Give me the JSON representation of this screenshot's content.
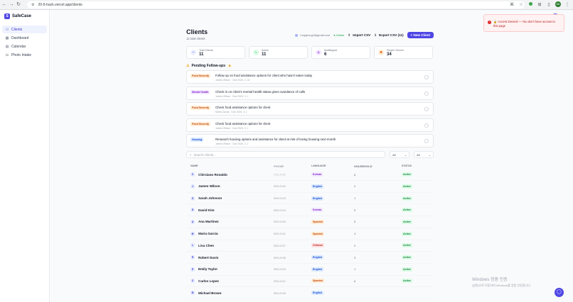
{
  "browser": {
    "url": "20-6-hack.vercel.app/clients",
    "back": "←",
    "forward": "→",
    "reload": "↻"
  },
  "brand": {
    "logo": "S",
    "name": "SafeCase"
  },
  "sidebar": {
    "items": [
      {
        "label": "Clients",
        "icon": "users-icon",
        "glyph": "⚇"
      },
      {
        "label": "Dashboard",
        "icon": "dashboard-icon",
        "glyph": "▦"
      },
      {
        "label": "Calendar",
        "icon": "calendar-icon",
        "glyph": "▤"
      },
      {
        "label": "Photo Intake",
        "icon": "camera-icon",
        "glyph": "◘"
      }
    ]
  },
  "header": {
    "title": "Clients",
    "subtitle": "11 total clients",
    "email": "hoipjeong2@gmail.com",
    "online": "● Online",
    "import_label": "Import CSV",
    "export_label": "Export CSV (11)",
    "new_label": "+ New Client"
  },
  "stats": [
    {
      "label": "Total Clients",
      "value": "11",
      "icon": "users-icon",
      "glyph": "⚇",
      "bg": "#eef2ff",
      "fg": "#4f46e5"
    },
    {
      "label": "Active",
      "value": "11",
      "icon": "activity-icon",
      "glyph": "∿",
      "bg": "#dcfce7",
      "fg": "#16a34a"
    },
    {
      "label": "Multilingual",
      "value": "6",
      "icon": "globe-icon",
      "glyph": "◍",
      "bg": "#f3e8ff",
      "fg": "#9333ea"
    },
    {
      "label": "People Served",
      "value": "34",
      "icon": "people-icon",
      "glyph": "⚉",
      "bg": "#ffedd5",
      "fg": "#ea580c"
    }
  ],
  "followups": {
    "title": "Pending Follow-ups",
    "count": "5",
    "items": [
      {
        "tag": "Food Security",
        "text": "Follow up on food assistance options for client who hasn't eaten today",
        "meta": "James Wilson · Due 2026. 2. 16"
      },
      {
        "tag": "Mental Health",
        "text": "Check in on client's mental health status given avoidance of calls",
        "meta": "James Wilson · Due 2026. 3. 1"
      },
      {
        "tag": "Food Security",
        "text": "Check food assistance options for client",
        "meta": "Maria Garcia · Due 2026. 3. 1"
      },
      {
        "tag": "Food Security",
        "text": "Check food assistance options for client",
        "meta": "James Wilson · Due 2026. 3. 1"
      },
      {
        "tag": "Housing",
        "text": "Research housing options and assistance for client at risk of losing housing next month",
        "meta": "James Wilson · Due 2026. 3. 1"
      }
    ]
  },
  "tag_colors": {
    "Food Security": {
      "bg": "#ffedd5",
      "fg": "#c2410c"
    },
    "Mental Health": {
      "bg": "#f3e8ff",
      "fg": "#7e22ce"
    },
    "Housing": {
      "bg": "#dbeafe",
      "fg": "#1d4ed8"
    }
  },
  "filters": {
    "search_placeholder": "Search clients...",
    "select1": "All",
    "select2": "All"
  },
  "table": {
    "headers": [
      "NAME",
      "PHONE",
      "LANGUAGE",
      "HOUSEHOLD",
      "STATUS"
    ],
    "rows": [
      {
        "initial": "C",
        "name": "Chirsiano Ronaldo",
        "phone": "777-7777",
        "language": "Korean",
        "household": "6",
        "status": "Active"
      },
      {
        "initial": "J",
        "name": "James Wilson",
        "phone": "555-0102",
        "language": "English",
        "household": "2",
        "status": "Active"
      },
      {
        "initial": "S",
        "name": "Sarah Johnson",
        "phone": "555-0103",
        "language": "English",
        "household": "1",
        "status": "Active"
      },
      {
        "initial": "D",
        "name": "David Kim",
        "phone": "555-0104",
        "language": "Korean",
        "household": "5",
        "status": "Active"
      },
      {
        "initial": "A",
        "name": "Ana Martinez",
        "phone": "555-0105",
        "language": "Spanish",
        "household": "5",
        "status": "Active"
      },
      {
        "initial": "M",
        "name": "Maria Garcia",
        "phone": "555-0101",
        "language": "Spanish",
        "household": "4",
        "status": "Active"
      },
      {
        "initial": "L",
        "name": "Lisa Chen",
        "phone": "555-0107",
        "language": "Chinese",
        "household": "2",
        "status": "Active"
      },
      {
        "initial": "R",
        "name": "Robert Davis",
        "phone": "555-0108",
        "language": "English",
        "household": "3",
        "status": "Active"
      },
      {
        "initial": "E",
        "name": "Emily Taylor",
        "phone": "555-0109",
        "language": "English",
        "household": "1",
        "status": "Active"
      },
      {
        "initial": "C",
        "name": "Carlos Lopez",
        "phone": "555-0110",
        "language": "Spanish",
        "household": "6",
        "status": "Active"
      },
      {
        "initial": "M",
        "name": "Michael Brown",
        "phone": "555-0106",
        "language": "English",
        "household": "",
        "status": ""
      }
    ]
  },
  "lang_colors": {
    "Korean": {
      "bg": "#f3e8ff",
      "fg": "#7e22ce"
    },
    "English": {
      "bg": "#dbeafe",
      "fg": "#1d4ed8"
    },
    "Spanish": {
      "bg": "#ffedd5",
      "fg": "#c2410c"
    },
    "Chinese": {
      "bg": "#fee2e2",
      "fg": "#b91c1c"
    }
  },
  "toast": {
    "icon": "!",
    "text": "🔒 Access Denied — You don't have access to this page"
  },
  "watermark": {
    "line1": "Windows 정품 인증",
    "line2": "[설정]으로 이동하여 Windows를 정품 인증합니다."
  },
  "chat_fab": "◯"
}
